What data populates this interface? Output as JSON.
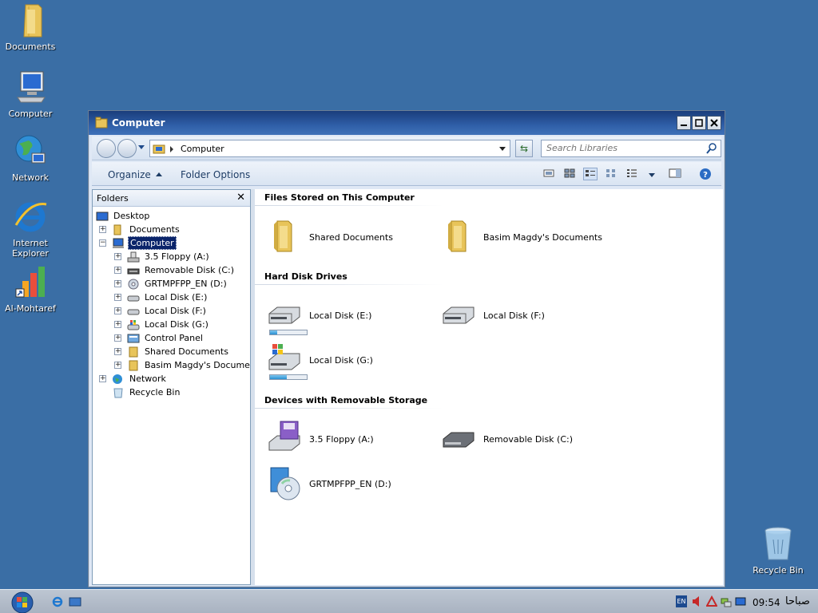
{
  "desktop": {
    "icons": [
      {
        "label": "Documents"
      },
      {
        "label": "Computer"
      },
      {
        "label": "Network"
      },
      {
        "label_line1": "Internet",
        "label_line2": "Explorer"
      },
      {
        "label": "Al-Mohtaref"
      },
      {
        "label": "Recycle Bin"
      }
    ]
  },
  "window": {
    "title": "Computer",
    "address": "Computer",
    "search_placeholder": "Search Libraries",
    "toolbar": {
      "organize": "Organize",
      "folder_options": "Folder Options"
    },
    "folders_header": "Folders",
    "tree": [
      {
        "label": "Desktop"
      },
      {
        "label": "Documents"
      },
      {
        "label": "Computer"
      },
      {
        "label": "3.5 Floppy (A:)"
      },
      {
        "label": "Removable Disk (C:)"
      },
      {
        "label": "GRTMPFPP_EN (D:)"
      },
      {
        "label": "Local Disk (E:)"
      },
      {
        "label": "Local Disk (F:)"
      },
      {
        "label": "Local Disk (G:)"
      },
      {
        "label": "Control Panel"
      },
      {
        "label": "Shared Documents"
      },
      {
        "label": "Basim Magdy's Documents"
      },
      {
        "label": "Network"
      },
      {
        "label": "Recycle Bin"
      }
    ],
    "groups": {
      "files": {
        "title": "Files Stored on This Computer",
        "items": [
          {
            "label": "Shared Documents"
          },
          {
            "label": "Basim Magdy's Documents"
          }
        ]
      },
      "drives": {
        "title": "Hard Disk Drives",
        "items": [
          {
            "label": "Local Disk (E:)",
            "usage": 0.2
          },
          {
            "label": "Local Disk (F:)"
          },
          {
            "label": "Local Disk (G:)",
            "usage": 0.45
          }
        ]
      },
      "removable": {
        "title": "Devices with Removable Storage",
        "items": [
          {
            "label": "3.5 Floppy (A:)"
          },
          {
            "label": "Removable Disk (C:)"
          },
          {
            "label": "GRTMPFPP_EN (D:)"
          }
        ]
      }
    }
  },
  "taskbar": {
    "lang": "EN",
    "time": "09:54",
    "period": "صباحا"
  },
  "colors": {
    "desktop": "#3a6ea5",
    "selection": "#0a246a",
    "titlebar": "#2f5fa8"
  }
}
